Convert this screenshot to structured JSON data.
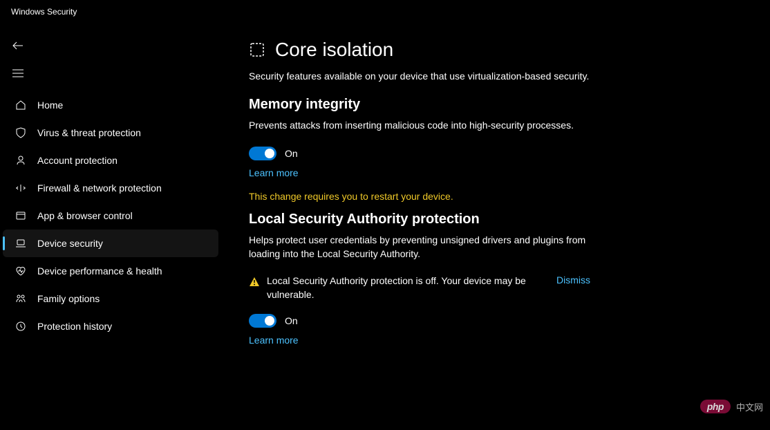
{
  "window": {
    "title": "Windows Security"
  },
  "sidebar": {
    "items": [
      {
        "id": "home",
        "label": "Home"
      },
      {
        "id": "virus",
        "label": "Virus & threat protection"
      },
      {
        "id": "account",
        "label": "Account protection"
      },
      {
        "id": "firewall",
        "label": "Firewall & network protection"
      },
      {
        "id": "app",
        "label": "App & browser control"
      },
      {
        "id": "device",
        "label": "Device security",
        "selected": true
      },
      {
        "id": "perf",
        "label": "Device performance & health"
      },
      {
        "id": "family",
        "label": "Family options"
      },
      {
        "id": "history",
        "label": "Protection history"
      }
    ]
  },
  "page": {
    "title": "Core isolation",
    "description": "Security features available on your device that use virtualization-based security."
  },
  "memory_integrity": {
    "title": "Memory integrity",
    "description": "Prevents attacks from inserting malicious code into high-security processes.",
    "toggle_state": "On",
    "learn_more": "Learn more",
    "restart_message": "This change requires you to restart your device."
  },
  "lsa": {
    "title": "Local Security Authority protection",
    "description": "Helps protect user credentials by preventing unsigned drivers and plugins from loading into the Local Security Authority.",
    "warning": "Local Security Authority protection is off. Your device may be vulnerable.",
    "dismiss": "Dismiss",
    "toggle_state": "On",
    "learn_more": "Learn more"
  },
  "watermark": {
    "pill": "php",
    "text": "中文网"
  }
}
